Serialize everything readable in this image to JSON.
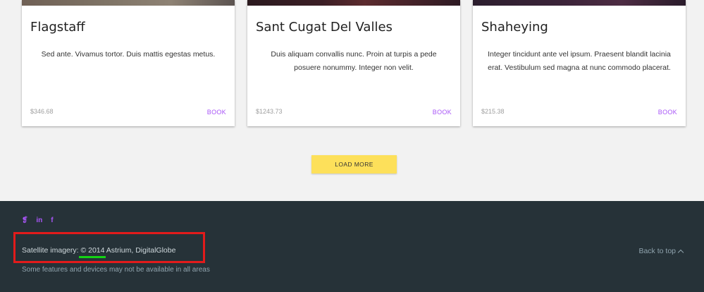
{
  "cards": [
    {
      "title": "Flagstaff",
      "description": "Sed ante. Vivamus tortor. Duis mattis egestas metus.",
      "price": "$346.68",
      "action": "BOOK"
    },
    {
      "title": "Sant Cugat Del Valles",
      "description": "Duis aliquam convallis nunc. Proin at turpis a pede posuere nonummy. Integer non velit.",
      "price": "$1243.73",
      "action": "BOOK"
    },
    {
      "title": "Shaheying",
      "description": "Integer tincidunt ante vel ipsum. Praesent blandit lacinia erat. Vestibulum sed magna at nunc commodo placerat.",
      "price": "$215.38",
      "action": "BOOK"
    }
  ],
  "load_more": "LOAD MORE",
  "footer": {
    "social": [
      "twitter-icon",
      "linkedin-icon",
      "facebook-icon"
    ],
    "social_glyphs": [
      "❡",
      "in",
      "f"
    ],
    "imagery_prefix": "Satellite imagery: ",
    "imagery_year": "© 2014",
    "imagery_suffix": " Astrium, DigitalGlobe",
    "notice": "Some features and devices may not be available in all areas",
    "back_to_top": "Back to top"
  },
  "colors": {
    "accent": "#a855f7",
    "button": "#fde05a",
    "footer_bg": "#263238",
    "highlight_box": "#e21b1b",
    "highlight_underline": "#14d414"
  }
}
